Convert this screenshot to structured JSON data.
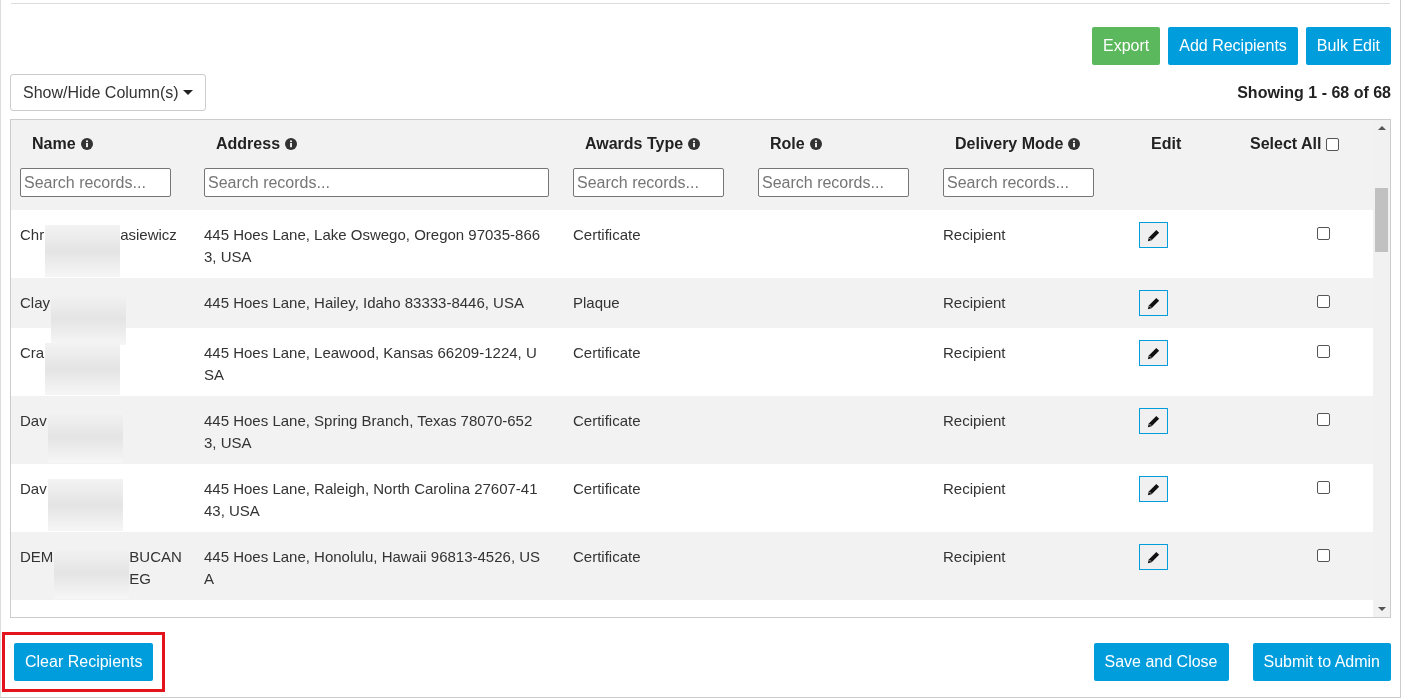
{
  "toolbar": {
    "buttons": [
      {
        "label": "Export",
        "kind": "success"
      },
      {
        "label": "Add Recipients",
        "kind": "primary"
      },
      {
        "label": "Bulk Edit",
        "kind": "primary"
      }
    ]
  },
  "column_toggle": {
    "label": "Show/Hide Column(s)"
  },
  "record_count": "Showing 1 - 68 of 68",
  "table": {
    "columns": [
      {
        "label": "Name",
        "kind": "search",
        "info": true,
        "placeholder": "Search records..."
      },
      {
        "label": "Address",
        "kind": "search",
        "info": true,
        "placeholder": "Search records..."
      },
      {
        "label": "Awards Type",
        "kind": "search",
        "info": true,
        "placeholder": "Search records..."
      },
      {
        "label": "Role",
        "kind": "search",
        "info": true,
        "placeholder": "Search records..."
      },
      {
        "label": "Delivery Mode",
        "kind": "search",
        "info": true,
        "placeholder": "Search records..."
      },
      {
        "label": "Edit",
        "kind": "plain",
        "info": false
      },
      {
        "label": "Select All",
        "kind": "select",
        "info": false,
        "checked": false
      }
    ],
    "rows": [
      {
        "name": [
          "Chr",
          "asiewicz"
        ],
        "address": "445 Hoes Lane, Lake Oswego, Oregon 97035-8663, USA",
        "awards_type": "Certificate",
        "delivery_mode": "Recipient",
        "checked": false
      },
      {
        "name": [
          "Clay"
        ],
        "address": "445 Hoes Lane, Hailey, Idaho 83333-8446, USA",
        "awards_type": "Plaque",
        "delivery_mode": "Recipient",
        "checked": false
      },
      {
        "name": [
          "Cra"
        ],
        "address": "445 Hoes Lane, Leawood, Kansas 66209-1224, USA",
        "awards_type": "Certificate",
        "delivery_mode": "Recipient",
        "checked": false
      },
      {
        "name": [
          "Dav"
        ],
        "address": "445 Hoes Lane, Spring Branch, Texas 78070-6523, USA",
        "awards_type": "Certificate",
        "delivery_mode": "Recipient",
        "checked": false
      },
      {
        "name": [
          "Dav"
        ],
        "address": "445 Hoes Lane, Raleigh, North Carolina 27607-4143, USA",
        "awards_type": "Certificate",
        "delivery_mode": "Recipient",
        "checked": false
      },
      {
        "name": [
          "DEM",
          "BUCANEG"
        ],
        "address": "445 Hoes Lane, Honolulu, Hawaii 96813-4526, USA",
        "awards_type": "Certificate",
        "delivery_mode": "Recipient",
        "checked": false
      }
    ]
  },
  "footer": {
    "left": {
      "label": "Clear Recipients",
      "highlighted": true
    },
    "right": [
      {
        "label": "Save and Close"
      },
      {
        "label": "Submit to Admin"
      }
    ]
  }
}
